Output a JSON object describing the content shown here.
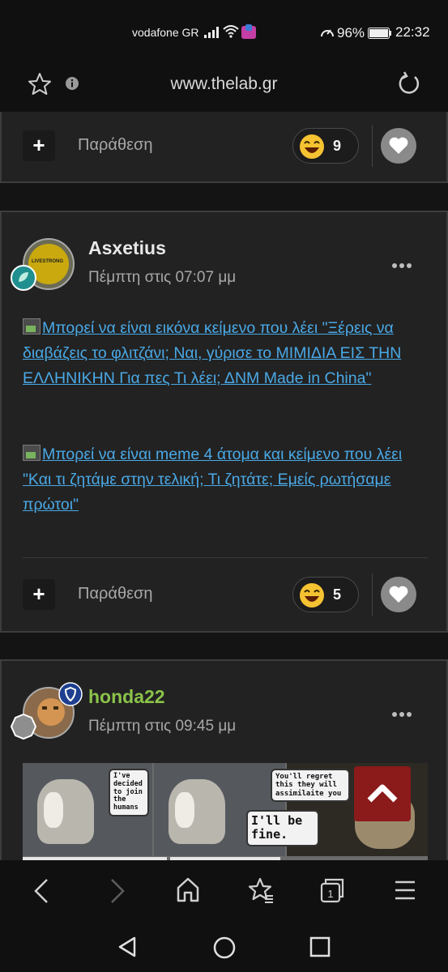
{
  "status_bar": {
    "carrier": "vodafone GR",
    "battery": "96%",
    "time": "22:32"
  },
  "browser": {
    "url": "www.thelab.gr"
  },
  "posts": [
    {
      "actions": {
        "quote_label": "Παράθεση",
        "reaction_count": "9"
      }
    },
    {
      "author": "Asxetius",
      "date": "Πέμπτη στις 07:07 μμ",
      "avatar_text": "LIVESTRONG",
      "images": [
        {
          "alt": "Μπορεί να είναι εικόνα κείμενο που λέει \"Ξέρεις να διαβάζεις το φλιτζάνι; Ναι, γύρισε το ΜΙΜΙΔΙΑ ΕΙΣ ΤΗΝ ΕΛΛΗΝΙΚΗΝ Για πες Τι λέει; ΔΝΜ Made in China\""
        },
        {
          "alt": "Μπορεί να είναι meme 4 άτομα και κείμενο που λέει \"Και τι ζητάμε στην τελική; Τι ζητάτε; Εμείς ρωτήσαμε πρώτοι\""
        }
      ],
      "actions": {
        "quote_label": "Παράθεση",
        "reaction_count": "5"
      }
    },
    {
      "author": "honda22",
      "date": "Πέμπτη στις 09:45 μμ",
      "author_color": "#8bc34a",
      "meme": {
        "bubble1": "I've decided to join the humans",
        "bubble2": "You'll regret this they will assimilaite you",
        "bubble3": "I'll be fine."
      }
    }
  ],
  "colors": {
    "link": "#4aa9e6",
    "scroll_top_button": "#8b1a1a",
    "card_bg": "#222222"
  }
}
